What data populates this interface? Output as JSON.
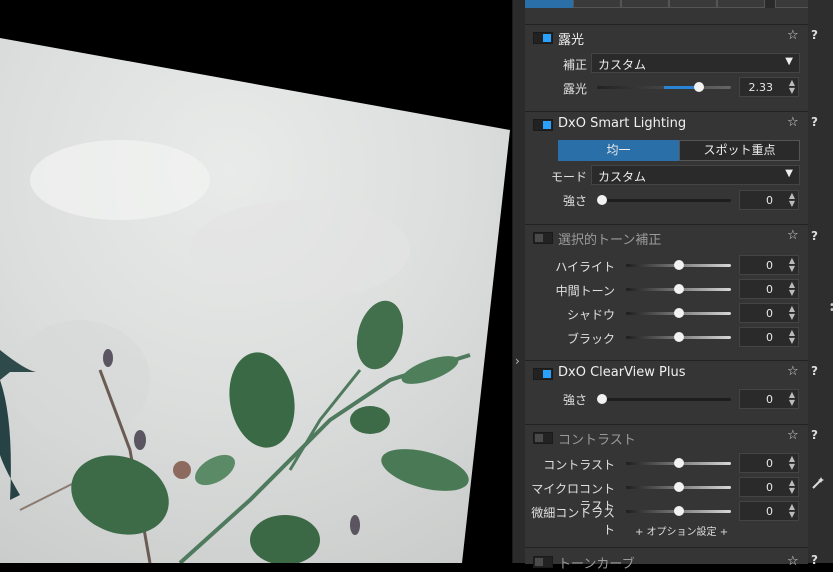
{
  "colors": {
    "accent": "#2ba0ff",
    "panel": "#353535",
    "selected": "#2a6fa8"
  },
  "panel_right": {
    "more_icon": "vertical-dots-icon",
    "wand_icon": "magic-wand-icon"
  },
  "strip": {
    "chevron": "›"
  },
  "sections": {
    "exposure": {
      "title": "露光",
      "enabled": true,
      "correction_label": "補正",
      "correction_value": "カスタム",
      "exposure_label": "露光",
      "exposure_value": "2.33",
      "exposure_level": 0.78
    },
    "smart_lighting": {
      "title": "DxO Smart Lighting",
      "enabled": true,
      "seg_uniform": "均一",
      "seg_spot": "スポット重点",
      "mode_label": "モード",
      "mode_value": "カスタム",
      "strength_label": "強さ",
      "strength_value": "0",
      "strength_level": 0.0
    },
    "selective_tone": {
      "title": "選択的トーン補正",
      "enabled": false,
      "rows": [
        {
          "label": "ハイライト",
          "value": "0",
          "level": 0.5
        },
        {
          "label": "中間トーン",
          "value": "0",
          "level": 0.5
        },
        {
          "label": "シャドウ",
          "value": "0",
          "level": 0.5
        },
        {
          "label": "ブラック",
          "value": "0",
          "level": 0.5
        }
      ]
    },
    "clearview": {
      "title": "DxO ClearView Plus",
      "enabled": true,
      "strength_label": "強さ",
      "strength_value": "0",
      "strength_level": 0.0
    },
    "contrast": {
      "title": "コントラスト",
      "enabled": false,
      "rows": [
        {
          "label": "コントラスト",
          "value": "0",
          "level": 0.5
        },
        {
          "label": "マイクロコントラスト",
          "value": "0",
          "level": 0.5
        },
        {
          "label": "微細コントラスト",
          "value": "0",
          "level": 0.5
        }
      ],
      "options_label": "+ オプション設定 +"
    },
    "tone_curve": {
      "title": "トーンカーブ",
      "enabled": false
    }
  },
  "common": {
    "star": "☆",
    "help": "?",
    "spin": "⌃⌄"
  }
}
